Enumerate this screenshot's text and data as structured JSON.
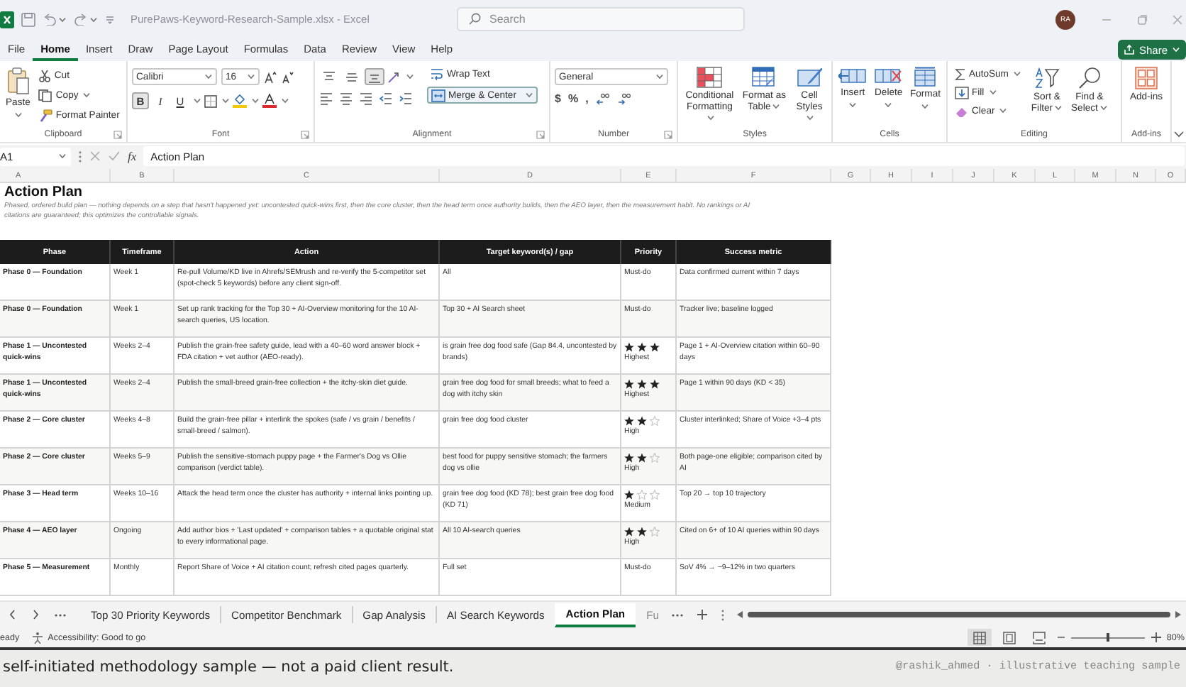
{
  "window": {
    "title": "PurePaws-Keyword-Research-Sample.xlsx - Excel",
    "search": {
      "placeholder": "Search"
    },
    "account": {
      "initials": "RA"
    }
  },
  "menu_tabs": [
    {
      "label": "File",
      "selected": false
    },
    {
      "label": "Home",
      "selected": true
    },
    {
      "label": "Insert",
      "selected": false
    },
    {
      "label": "Draw",
      "selected": false
    },
    {
      "label": "Page Layout",
      "selected": false
    },
    {
      "label": "Formulas",
      "selected": false
    },
    {
      "label": "Data",
      "selected": false
    },
    {
      "label": "Review",
      "selected": false
    },
    {
      "label": "View",
      "selected": false
    },
    {
      "label": "Help",
      "selected": false
    }
  ],
  "share_button": "Share",
  "ribbon": [
    {
      "kind": "clipboard",
      "label": "Clipboard",
      "paste": "Paste",
      "cut": "Cut",
      "copy": "Copy",
      "format_painter": "Format Painter"
    },
    {
      "kind": "font",
      "label": "Font",
      "font_name": "Calibri",
      "font_size": "16",
      "styles": [
        {
          "label": "B",
          "on": true
        },
        {
          "label": "I",
          "on": false
        },
        {
          "label": "U",
          "on": false
        }
      ]
    },
    {
      "kind": "alignment",
      "label": "Alignment",
      "vertical_align": [
        {
          "selected": false
        },
        {
          "selected": false
        },
        {
          "selected": true
        }
      ],
      "wrap_text": "Wrap Text",
      "merge_center": "Merge & Center",
      "merge_on": true
    },
    {
      "kind": "number",
      "label": "Number",
      "format": "General",
      "symbols": [
        "$",
        "%",
        ","
      ]
    },
    {
      "kind": "styles",
      "label": "Styles",
      "buttons": [
        "Conditional Formatting",
        "Format as Table",
        "Cell Styles"
      ]
    },
    {
      "kind": "cells",
      "label": "Cells",
      "buttons": [
        "Insert",
        "Delete",
        "Format"
      ]
    },
    {
      "kind": "editing",
      "label": "Editing",
      "autosum": "AutoSum",
      "fill": "Fill",
      "clear": "Clear",
      "sort": "Sort & Filter",
      "find": "Find & Select"
    },
    {
      "kind": "addins",
      "label": "Add-ins",
      "button": "Add-ins"
    }
  ],
  "formula_bar": {
    "name_box": "A1",
    "function_label": "fx",
    "formula": "Action Plan"
  },
  "columns": [
    "A",
    "B",
    "C",
    "D",
    "E",
    "F",
    "G",
    "H",
    "I",
    "J",
    "K",
    "L",
    "M",
    "N",
    "O"
  ],
  "sheet": {
    "title": "Action Plan",
    "description": "Phased, ordered build plan — nothing depends on a step that hasn't happened yet: uncontested quick-wins first, then the core cluster, then the head term once authority builds, then the AEO layer, then the measurement habit. No rankings or AI citations are guaranteed; this optimizes the controllable signals.",
    "table": {
      "columns": [
        "Phase",
        "Timeframe",
        "Action",
        "Target keyword(s) / gap",
        "Priority",
        "Success metric"
      ],
      "rows": [
        {
          "phase": "Phase 0 — Foundation",
          "timeframe": "Week 1",
          "action": "Re-pull Volume/KD live in Ahrefs/SEMrush and re-verify the 5-competitor set (spot-check 5 keywords) before any client sign-off.",
          "target": "All",
          "priority": "Must-do",
          "metric": "Data confirmed current within 7 days"
        },
        {
          "phase": "Phase 0 — Foundation",
          "timeframe": "Week 1",
          "action": "Set up rank tracking for the Top 30 + AI-Overview monitoring for the 10 AI-search queries, US location.",
          "target": "Top 30 + AI Search sheet",
          "priority": "Must-do",
          "metric": "Tracker live; baseline logged"
        },
        {
          "phase": "Phase 1 — Uncontested quick-wins",
          "timeframe": "Weeks 2–4",
          "action": "Publish the grain-free safety guide, lead with a 40–60 word answer block + FDA citation + vet author (AEO-ready).",
          "target": "is grain free dog food safe (Gap 84.4, uncontested by brands)",
          "stars": 3,
          "priority": "Highest",
          "metric": "Page 1 + AI-Overview citation within 60–90 days"
        },
        {
          "phase": "Phase 1 — Uncontested quick-wins",
          "timeframe": "Weeks 2–4",
          "action": "Publish the small-breed grain-free collection + the itchy-skin diet guide.",
          "target": "grain free dog food for small breeds; what to feed a dog with itchy skin",
          "stars": 3,
          "priority": "Highest",
          "metric": "Page 1 within 90 days (KD < 35)"
        },
        {
          "phase": "Phase 2 — Core cluster",
          "timeframe": "Weeks 4–8",
          "action": "Build the grain-free pillar + interlink the spokes (safe / vs grain / benefits / small-breed / salmon).",
          "target": "grain free dog food cluster",
          "stars": 2,
          "priority": "High",
          "metric": "Cluster interlinked; Share of Voice +3–4 pts"
        },
        {
          "phase": "Phase 2 — Core cluster",
          "timeframe": "Weeks 5–9",
          "action": "Publish the sensitive-stomach puppy page + the Farmer's Dog vs Ollie comparison (verdict table).",
          "target": "best food for puppy sensitive stomach; the farmers dog vs ollie",
          "stars": 2,
          "priority": "High",
          "metric": "Both page-one eligible; comparison cited by AI"
        },
        {
          "phase": "Phase 3 — Head term",
          "timeframe": "Weeks 10–16",
          "action": "Attack the head term once the cluster has authority + internal links pointing up.",
          "target": "grain free dog food (KD 78); best grain free dog food (KD 71)",
          "stars": 1,
          "priority": "Medium",
          "metric": "Top 20 → top 10 trajectory"
        },
        {
          "phase": "Phase 4 — AEO layer",
          "timeframe": "Ongoing",
          "action": "Add author bios + 'Last updated' + comparison tables + a quotable original stat to every informational page.",
          "target": "All 10 AI-search queries",
          "stars": 2,
          "priority": "High",
          "metric": "Cited on 6+ of 10 AI queries within 90 days"
        },
        {
          "phase": "Phase 5 — Measurement",
          "timeframe": "Monthly",
          "action": "Report Share of Voice + AI citation count; refresh cited pages quarterly.",
          "target": "Full set",
          "priority": "Must-do",
          "metric": "SoV 4% → ~9–12% in two quarters"
        }
      ]
    }
  },
  "sheet_tabs": [
    {
      "label": "Top 30 Priority Keywords",
      "selected": false
    },
    {
      "label": "Competitor Benchmark",
      "selected": false
    },
    {
      "label": "Gap Analysis",
      "selected": false
    },
    {
      "label": "AI Search Keywords",
      "selected": false
    },
    {
      "label": "Action Plan",
      "selected": true
    },
    {
      "label": "Fu",
      "selected": false
    }
  ],
  "status_bar": {
    "ready": "eady",
    "accessibility": "Accessibility: Good to go",
    "views": [
      {
        "selected": true
      },
      {
        "selected": false
      },
      {
        "selected": false
      }
    ],
    "zoom_slider": {
      "level": 0.5
    },
    "zoom": "80%"
  },
  "caption": {
    "left": "self-initiated methodology sample — not a paid client result.",
    "right": "@rashik_ahmed · illustrative teaching sample"
  }
}
